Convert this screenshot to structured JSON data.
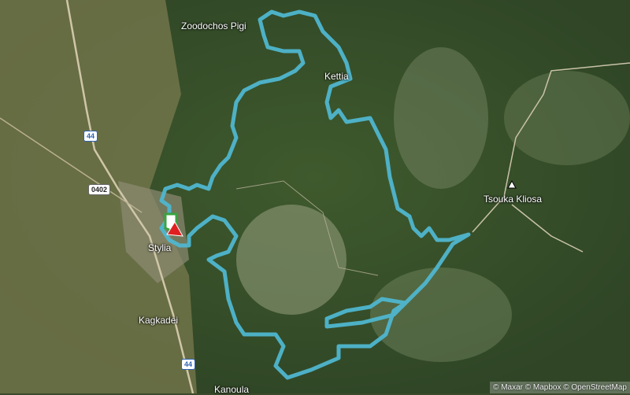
{
  "places": [
    {
      "name": "Zoodochos Pigi"
    },
    {
      "name": "Kettia"
    },
    {
      "name": "Tsouka Kliosa"
    },
    {
      "name": "Stylia"
    },
    {
      "name": "Kagkadei"
    },
    {
      "name": "Kanoula"
    }
  ],
  "road_shields": [
    {
      "label": "44"
    },
    {
      "label": "0402"
    },
    {
      "label": "44"
    }
  ],
  "attribution": "© Maxar © Mapbox © OpenStreetMap",
  "colors": {
    "route": "#4fb6cf",
    "start_flag": "#3aa33f",
    "end_flag": "#e02020"
  },
  "icons": {
    "peak": "triangle-peak-icon",
    "start": "start-flag-icon",
    "finish": "finish-flag-icon"
  }
}
